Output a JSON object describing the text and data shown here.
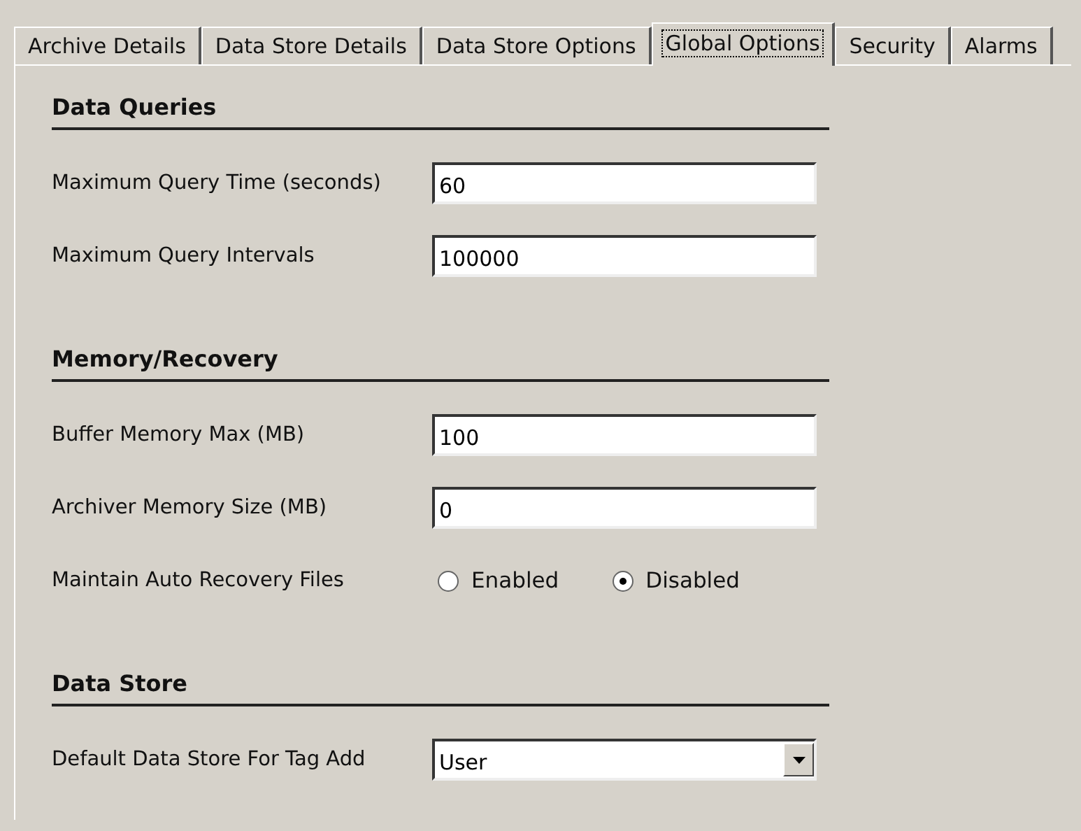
{
  "tabs": [
    {
      "label": "Archive Details",
      "selected": false
    },
    {
      "label": "Data Store Details",
      "selected": false
    },
    {
      "label": "Data Store Options",
      "selected": false
    },
    {
      "label": "Global Options",
      "selected": true
    },
    {
      "label": "Security",
      "selected": false
    },
    {
      "label": "Alarms",
      "selected": false
    }
  ],
  "sections": [
    {
      "title": "Data Queries",
      "rows": [
        {
          "kind": "text",
          "label": "Maximum Query Time (seconds)",
          "value": "60"
        },
        {
          "kind": "text",
          "label": "Maximum Query Intervals",
          "value": "100000"
        }
      ]
    },
    {
      "title": "Memory/Recovery",
      "rows": [
        {
          "kind": "text",
          "label": "Buffer Memory Max (MB)",
          "value": "100"
        },
        {
          "kind": "text",
          "label": "Archiver Memory Size (MB)",
          "value": "0"
        },
        {
          "kind": "radio",
          "label": "Maintain Auto Recovery Files",
          "options": [
            {
              "label": "Enabled",
              "selected": false
            },
            {
              "label": "Disabled",
              "selected": true
            }
          ]
        }
      ]
    },
    {
      "title": "Data Store",
      "rows": [
        {
          "kind": "select",
          "label": "Default Data Store For Tag Add",
          "value": "User"
        }
      ]
    }
  ]
}
